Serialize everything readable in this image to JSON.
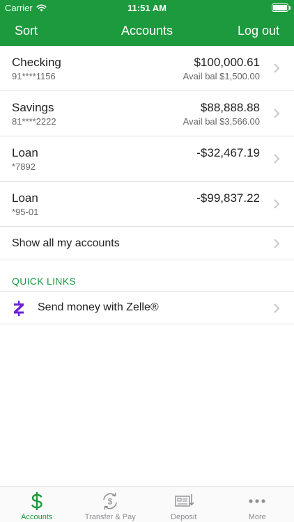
{
  "status_bar": {
    "carrier": "Carrier",
    "time": "11:51 AM"
  },
  "nav": {
    "left": "Sort",
    "title": "Accounts",
    "right": "Log out"
  },
  "accounts": [
    {
      "name": "Checking",
      "number": "91****1156",
      "amount": "$100,000.61",
      "avail": "Avail bal $1,500.00"
    },
    {
      "name": "Savings",
      "number": "81****2222",
      "amount": "$88,888.88",
      "avail": "Avail bal $3,566.00"
    },
    {
      "name": "Loan",
      "number": "*7892",
      "amount": "-$32,467.19",
      "avail": ""
    },
    {
      "name": "Loan",
      "number": "*95-01",
      "amount": "-$99,837.22",
      "avail": ""
    }
  ],
  "show_all": "Show all my accounts",
  "quick_links": {
    "header": "QUICK LINKS",
    "items": [
      {
        "label": "Send money with Zelle®",
        "icon": "zelle-icon"
      }
    ]
  },
  "tabs": [
    {
      "label": "Accounts",
      "icon": "dollar-icon",
      "active": true
    },
    {
      "label": "Transfer & Pay",
      "icon": "transfer-icon",
      "active": false
    },
    {
      "label": "Deposit",
      "icon": "deposit-icon",
      "active": false
    },
    {
      "label": "More",
      "icon": "more-icon",
      "active": false
    }
  ],
  "colors": {
    "brand": "#1d9a3e",
    "zelle": "#6d1ed4",
    "inactive": "#8e8e93"
  }
}
